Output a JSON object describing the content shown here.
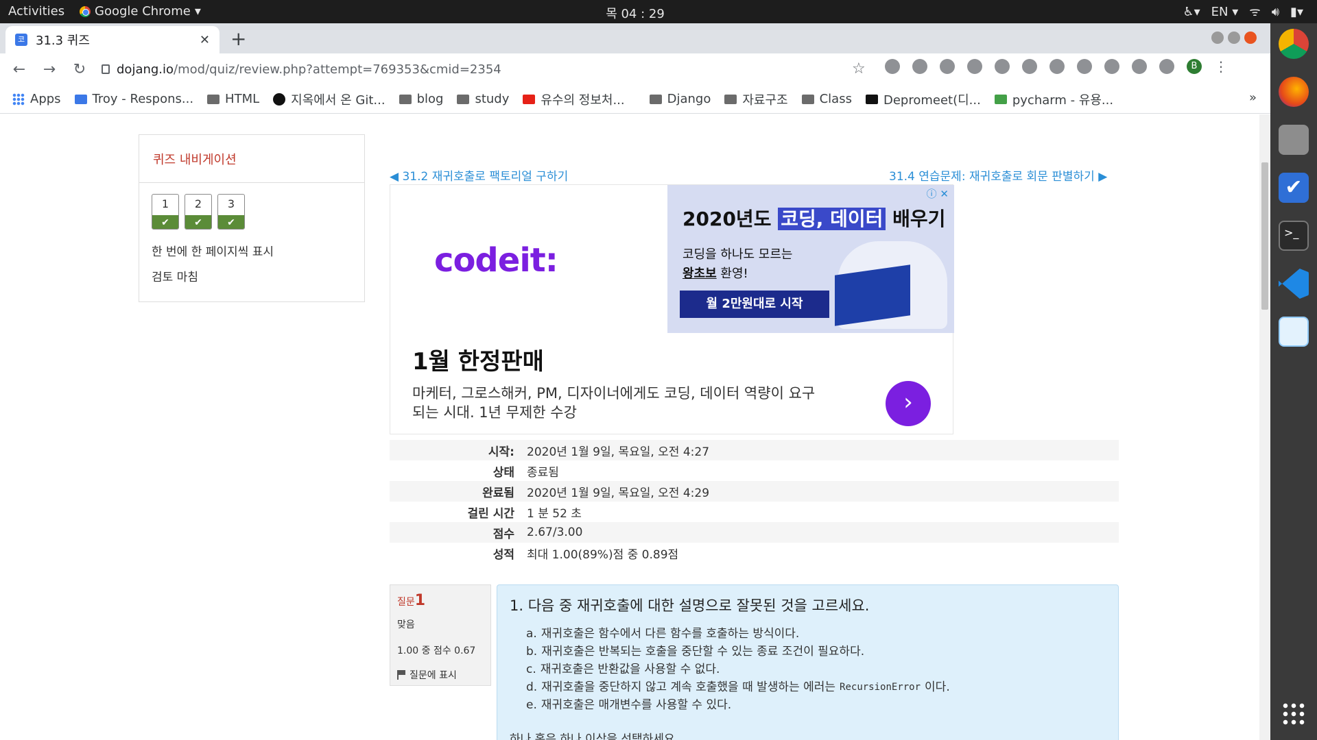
{
  "os": {
    "activities": "Activities",
    "app_name": "Google Chrome",
    "clock": "목 04 : 29",
    "lang": "EN"
  },
  "browser": {
    "tab_title": "31.3 퀴즈",
    "url_host": "dojang.io",
    "url_path": "/mod/quiz/review.php?attempt=769353&cmid=2354",
    "profile_initial": "B",
    "bookmarks": [
      "Apps",
      "Troy - Respons...",
      "HTML",
      "지옥에서 온 Git...",
      "blog",
      "study",
      "유수의 정보처...",
      "Django",
      "자료구조",
      "Class",
      "Depromeet(디...",
      "pycharm - 유용..."
    ]
  },
  "quiz_nav": {
    "title": "퀴즈 내비게이션",
    "questions": [
      "1",
      "2",
      "3"
    ],
    "show_one_page": "한 번에 한 페이지씩 표시",
    "finish_review": "검토 마침"
  },
  "nav_links": {
    "prev": "◀ 31.2 재귀호출로 팩토리얼 구하기",
    "next": "31.4 연습문제: 재귀호출로 회문 판별하기 ▶"
  },
  "ad": {
    "logo": "codeit:",
    "banner_line1_pre": "2020년도 ",
    "banner_highlight": "코딩, 데이터",
    "banner_line1_post": " 배우기",
    "banner_line2": "코딩을 하나도 모르는",
    "banner_line3_bold": "왕초보",
    "banner_line3_rest": " 환영!",
    "banner_button": "월 2만원대로 시작",
    "headline": "1월 한정판매",
    "description": "마케터, 그로스해커, PM, 디자이너에게도 코딩, 데이터 역량이 요구되는 시대. 1년 무제한 수강"
  },
  "summary": {
    "rows": [
      {
        "k": "시작:",
        "v": "2020년 1월 9일, 목요일, 오전 4:27"
      },
      {
        "k": "상태",
        "v": "종료됨"
      },
      {
        "k": "완료됨",
        "v": "2020년 1월 9일, 목요일, 오전 4:29"
      },
      {
        "k": "걸린 시간",
        "v": "1 분 52 초"
      },
      {
        "k": "점수",
        "v": "2.67/3.00"
      },
      {
        "k": "성적",
        "v": "최대 1.00(89%)점 중 0.89점"
      }
    ]
  },
  "question": {
    "label": "질문",
    "number": "1",
    "state": "맞음",
    "mark": "1.00 중 점수 0.67",
    "flag": "질문에 표시",
    "text": "1. 다음 중 재귀호출에 대한 설명으로 잘못된 것을 고르세요.",
    "options": [
      {
        "letter": "a.",
        "text": "재귀호출은 함수에서 다른 함수를 호출하는 방식이다."
      },
      {
        "letter": "b.",
        "text": "재귀호출은 반복되는 호출을 중단할 수 있는 종료 조건이 필요하다."
      },
      {
        "letter": "c.",
        "text": "재귀호출은 반환값을 사용할 수 없다."
      },
      {
        "letter": "d.",
        "text": "재귀호출을 중단하지 않고 계속 호출했을 때 발생하는 에러는",
        "code": "RecursionError",
        "after": "이다."
      },
      {
        "letter": "e.",
        "text": "재귀호출은 매개변수를 사용할 수 있다."
      }
    ],
    "hint": "하나 혹은 하나 이상을 선택하세요."
  }
}
